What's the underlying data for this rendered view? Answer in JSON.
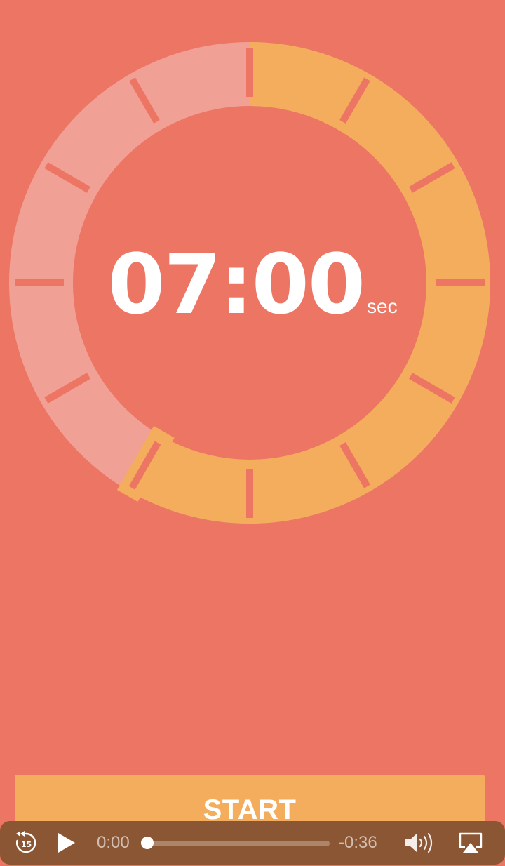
{
  "colors": {
    "background": "#ED7563",
    "ring_active": "#F3AD5C",
    "ring_inactive": "#F1A096",
    "button": "#F3AD5C",
    "text": "#FFFFFF",
    "player_bar": "#8B5634"
  },
  "timer": {
    "value": "07:00",
    "unit": "sec",
    "fill_fraction": 0.583
  },
  "actions": {
    "start_label": "START"
  },
  "player": {
    "elapsed": "0:00",
    "remaining": "-0:36",
    "progress_fraction": 0,
    "icons": {
      "skip_back": "skip-back-15-icon",
      "play": "play-icon",
      "volume": "volume-icon",
      "airplay": "airplay-icon"
    }
  }
}
